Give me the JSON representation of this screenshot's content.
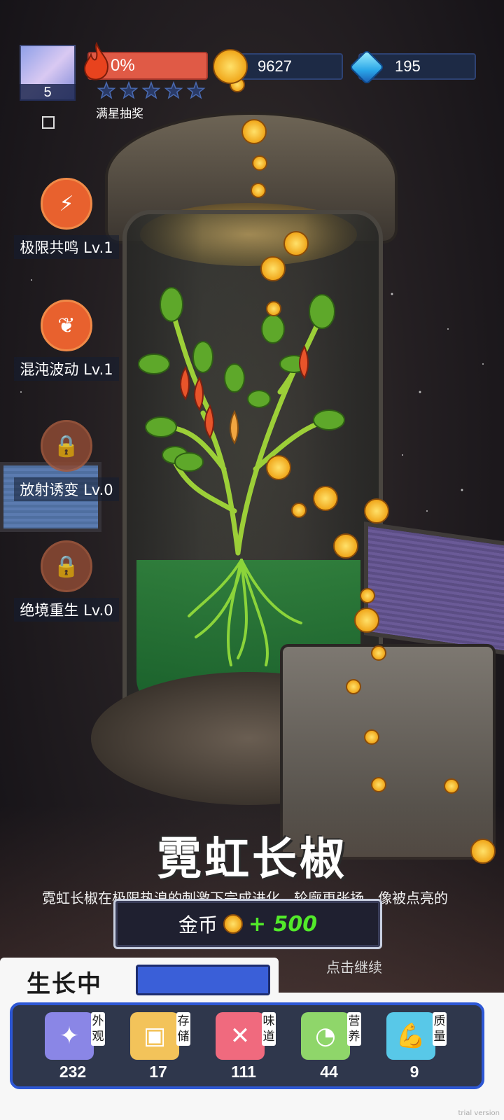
{
  "player": {
    "level": "5"
  },
  "heat": {
    "percent": "0%",
    "stars_filled": 0,
    "stars_total": 5,
    "star_reward_label": "满星抽奖"
  },
  "resources": {
    "coins": "9627",
    "gems": "195"
  },
  "skills": [
    {
      "label": "极限共鸣 Lv.1",
      "icon": "resonance-icon",
      "unlocked": true
    },
    {
      "label": "混沌波动 Lv.1",
      "icon": "chaos-wave-icon",
      "unlocked": true
    },
    {
      "label": "放射诱变 Lv.0",
      "icon": "lock-icon",
      "unlocked": false
    },
    {
      "label": "绝境重生 Lv.0",
      "icon": "lock-icon",
      "unlocked": false
    }
  ],
  "plant": {
    "name": "霓虹长椒",
    "description": "霓虹长椒在极限热浪的刺激下完成进化，轮廓更张扬，像被点亮的"
  },
  "reward": {
    "label": "金币",
    "amount": "+ 500"
  },
  "continue_hint": "点击继续",
  "growth": {
    "status_label": "生长中",
    "progress": 1.0
  },
  "stats": [
    {
      "tag": "外观",
      "value": "232",
      "icon": "sparkle-icon",
      "color": "#8a86e6"
    },
    {
      "tag": "存储",
      "value": "17",
      "icon": "box-icon",
      "color": "#f3c35a"
    },
    {
      "tag": "味道",
      "value": "111",
      "icon": "fork-knife-icon",
      "color": "#f06a7e"
    },
    {
      "tag": "营养",
      "value": "44",
      "icon": "fruit-icon",
      "color": "#8fd66a"
    },
    {
      "tag": "质量",
      "value": "9",
      "icon": "muscle-icon",
      "color": "#58c8e8"
    }
  ],
  "colors": {
    "accent_blue": "#2d57d5",
    "heat_red": "#e05a46",
    "reward_green": "#52ea2a"
  },
  "watermark": "trial version"
}
